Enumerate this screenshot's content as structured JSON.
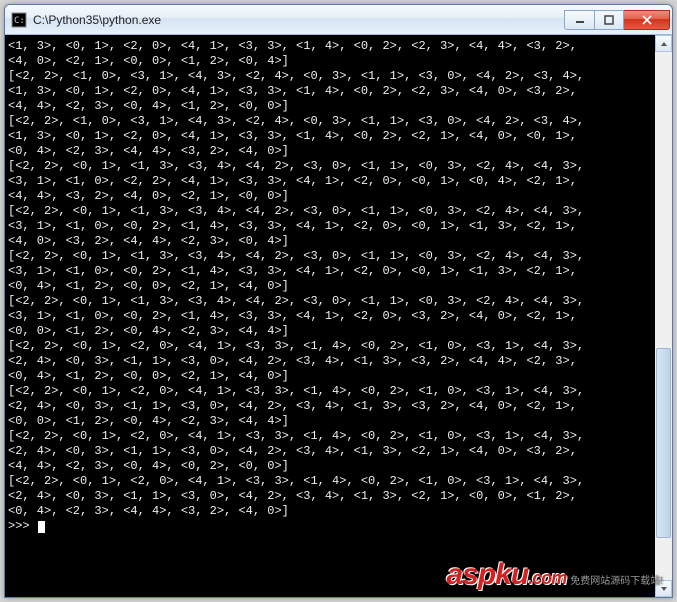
{
  "window": {
    "title": "C:\\Python35\\python.exe"
  },
  "console": {
    "lines": [
      "<1, 3>, <0, 1>, <2, 0>, <4, 1>, <3, 3>, <1, 4>, <0, 2>, <2, 3>, <4, 4>, <3, 2>,",
      "<4, 0>, <2, 1>, <0, 0>, <1, 2>, <0, 4>]",
      "[<2, 2>, <1, 0>, <3, 1>, <4, 3>, <2, 4>, <0, 3>, <1, 1>, <3, 0>, <4, 2>, <3, 4>,",
      "<1, 3>, <0, 1>, <2, 0>, <4, 1>, <3, 3>, <1, 4>, <0, 2>, <2, 3>, <4, 0>, <3, 2>,",
      "<4, 4>, <2, 3>, <0, 4>, <1, 2>, <0, 0>]",
      "[<2, 2>, <1, 0>, <3, 1>, <4, 3>, <2, 4>, <0, 3>, <1, 1>, <3, 0>, <4, 2>, <3, 4>,",
      "<1, 3>, <0, 1>, <2, 0>, <4, 1>, <3, 3>, <1, 4>, <0, 2>, <2, 1>, <4, 0>, <0, 1>,",
      "<0, 4>, <2, 3>, <4, 4>, <3, 2>, <4, 0>]",
      "[<2, 2>, <0, 1>, <1, 3>, <3, 4>, <4, 2>, <3, 0>, <1, 1>, <0, 3>, <2, 4>, <4, 3>,",
      "<3, 1>, <1, 0>, <2, 2>, <4, 1>, <3, 3>, <4, 1>, <2, 0>, <0, 1>, <0, 4>, <2, 1>,",
      "<4, 4>, <3, 2>, <4, 0>, <2, 1>, <0, 0>]",
      "[<2, 2>, <0, 1>, <1, 3>, <3, 4>, <4, 2>, <3, 0>, <1, 1>, <0, 3>, <2, 4>, <4, 3>,",
      "<3, 1>, <1, 0>, <0, 2>, <1, 4>, <3, 3>, <4, 1>, <2, 0>, <0, 1>, <1, 3>, <2, 1>,",
      "<4, 0>, <3, 2>, <4, 4>, <2, 3>, <0, 4>]",
      "[<2, 2>, <0, 1>, <1, 3>, <3, 4>, <4, 2>, <3, 0>, <1, 1>, <0, 3>, <2, 4>, <4, 3>,",
      "<3, 1>, <1, 0>, <0, 2>, <1, 4>, <3, 3>, <4, 1>, <2, 0>, <0, 1>, <1, 3>, <2, 1>,",
      "<0, 4>, <1, 2>, <0, 0>, <2, 1>, <4, 0>]",
      "[<2, 2>, <0, 1>, <1, 3>, <3, 4>, <4, 2>, <3, 0>, <1, 1>, <0, 3>, <2, 4>, <4, 3>,",
      "<3, 1>, <1, 0>, <0, 2>, <1, 4>, <3, 3>, <4, 1>, <2, 0>, <3, 2>, <4, 0>, <2, 1>,",
      "<0, 0>, <1, 2>, <0, 4>, <2, 3>, <4, 4>]",
      "[<2, 2>, <0, 1>, <2, 0>, <4, 1>, <3, 3>, <1, 4>, <0, 2>, <1, 0>, <3, 1>, <4, 3>,",
      "<2, 4>, <0, 3>, <1, 1>, <3, 0>, <4, 2>, <3, 4>, <1, 3>, <3, 2>, <4, 4>, <2, 3>,",
      "<0, 4>, <1, 2>, <0, 0>, <2, 1>, <4, 0>]",
      "[<2, 2>, <0, 1>, <2, 0>, <4, 1>, <3, 3>, <1, 4>, <0, 2>, <1, 0>, <3, 1>, <4, 3>,",
      "<2, 4>, <0, 3>, <1, 1>, <3, 0>, <4, 2>, <3, 4>, <1, 3>, <3, 2>, <4, 0>, <2, 1>,",
      "<0, 0>, <1, 2>, <0, 4>, <2, 3>, <4, 4>]",
      "[<2, 2>, <0, 1>, <2, 0>, <4, 1>, <3, 3>, <1, 4>, <0, 2>, <1, 0>, <3, 1>, <4, 3>,",
      "<2, 4>, <0, 3>, <1, 1>, <3, 0>, <4, 2>, <3, 4>, <1, 3>, <2, 1>, <4, 0>, <3, 2>,",
      "<4, 4>, <2, 3>, <0, 4>, <0, 2>, <0, 0>]",
      "[<2, 2>, <0, 1>, <2, 0>, <4, 1>, <3, 3>, <1, 4>, <0, 2>, <1, 0>, <3, 1>, <4, 3>,",
      "<2, 4>, <0, 3>, <1, 1>, <3, 0>, <4, 2>, <3, 4>, <1, 3>, <2, 1>, <0, 0>, <1, 2>,",
      "<0, 4>, <2, 3>, <4, 4>, <3, 2>, <4, 0>]",
      ">>> "
    ],
    "prompt": ">>> "
  },
  "watermark": {
    "main": "aspku",
    "tld": ".com",
    "sub": "免费网站源码下载站!"
  }
}
